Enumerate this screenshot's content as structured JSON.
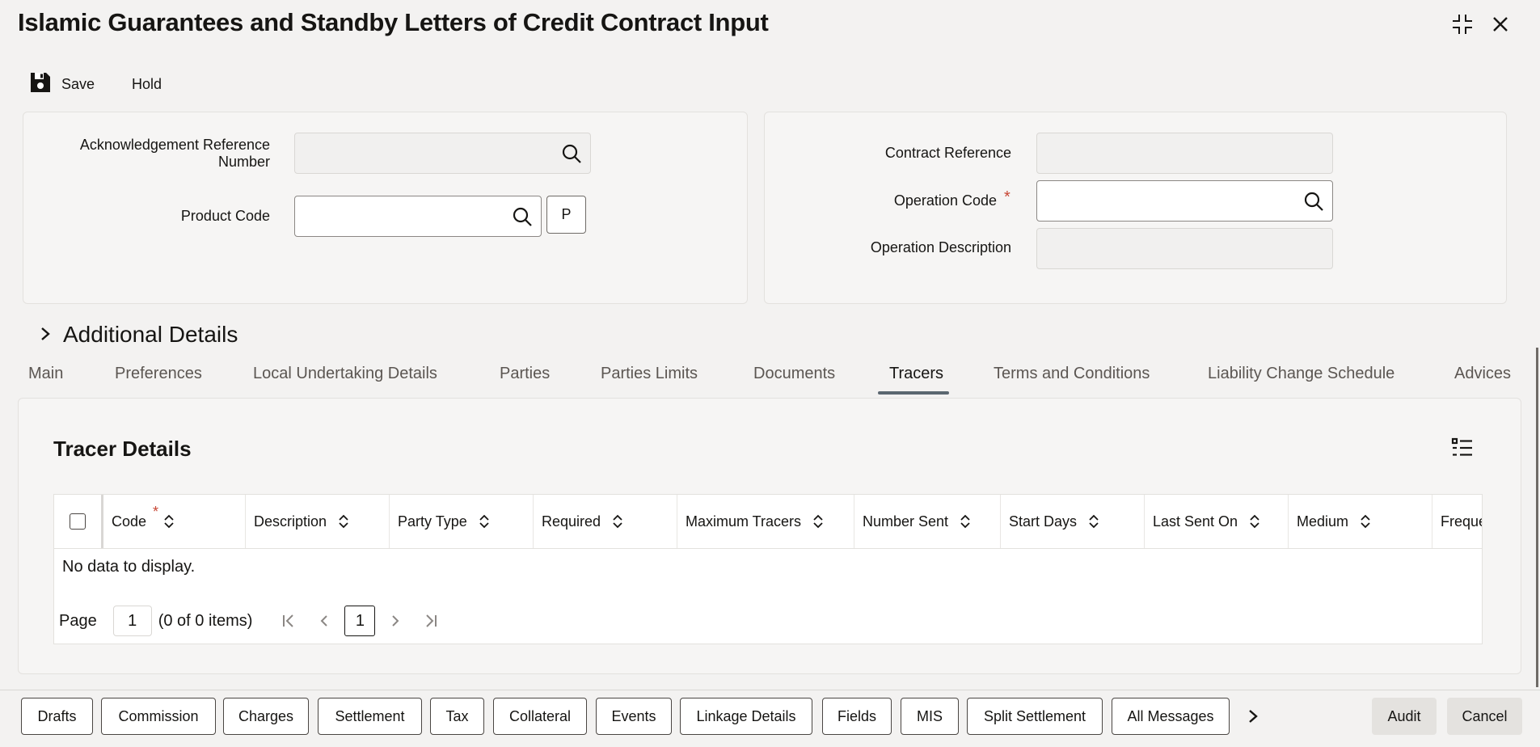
{
  "window": {
    "title": "Islamic Guarantees and Standby Letters of Credit Contract Input",
    "icons": [
      "minimize-icon",
      "close-icon"
    ]
  },
  "toolbar": {
    "save_label": "Save",
    "hold_label": "Hold"
  },
  "form": {
    "ack_ref_label_line1": "Acknowledgement Reference",
    "ack_ref_label_line2": "Number",
    "product_code_label": "Product Code",
    "product_button_label": "P",
    "contract_ref_label": "Contract Reference",
    "operation_code_label": "Operation Code",
    "operation_code_required": "*",
    "operation_desc_label": "Operation Description"
  },
  "additional_details": {
    "label": "Additional Details"
  },
  "tabs": [
    {
      "label": "Main"
    },
    {
      "label": "Preferences"
    },
    {
      "label": "Local Undertaking Details"
    },
    {
      "label": "Parties"
    },
    {
      "label": "Parties Limits"
    },
    {
      "label": "Documents"
    },
    {
      "label": "Tracers"
    },
    {
      "label": "Terms and Conditions"
    },
    {
      "label": "Liability Change Schedule"
    },
    {
      "label": "Advices"
    }
  ],
  "active_tab": "Tracers",
  "tracer": {
    "title": "Tracer Details",
    "columns": [
      {
        "label": "Code",
        "required": "*"
      },
      {
        "label": "Description"
      },
      {
        "label": "Party Type"
      },
      {
        "label": "Required"
      },
      {
        "label": "Maximum Tracers"
      },
      {
        "label": "Number Sent"
      },
      {
        "label": "Start Days"
      },
      {
        "label": "Last Sent On"
      },
      {
        "label": "Medium"
      },
      {
        "label": "Freque"
      }
    ],
    "no_data": "No data to display.",
    "pager": {
      "page_label": "Page",
      "page_value": "1",
      "summary": "(0 of 0 items)",
      "current": "1"
    }
  },
  "footer": {
    "buttons": [
      {
        "label": "Drafts"
      },
      {
        "label": "Commission"
      },
      {
        "label": "Charges"
      },
      {
        "label": "Settlement"
      },
      {
        "label": "Tax"
      },
      {
        "label": "Collateral"
      },
      {
        "label": "Events"
      },
      {
        "label": "Linkage Details"
      },
      {
        "label": "Fields"
      },
      {
        "label": "MIS"
      },
      {
        "label": "Split Settlement"
      },
      {
        "label": "All Messages"
      }
    ],
    "audit_label": "Audit",
    "cancel_label": "Cancel"
  }
}
